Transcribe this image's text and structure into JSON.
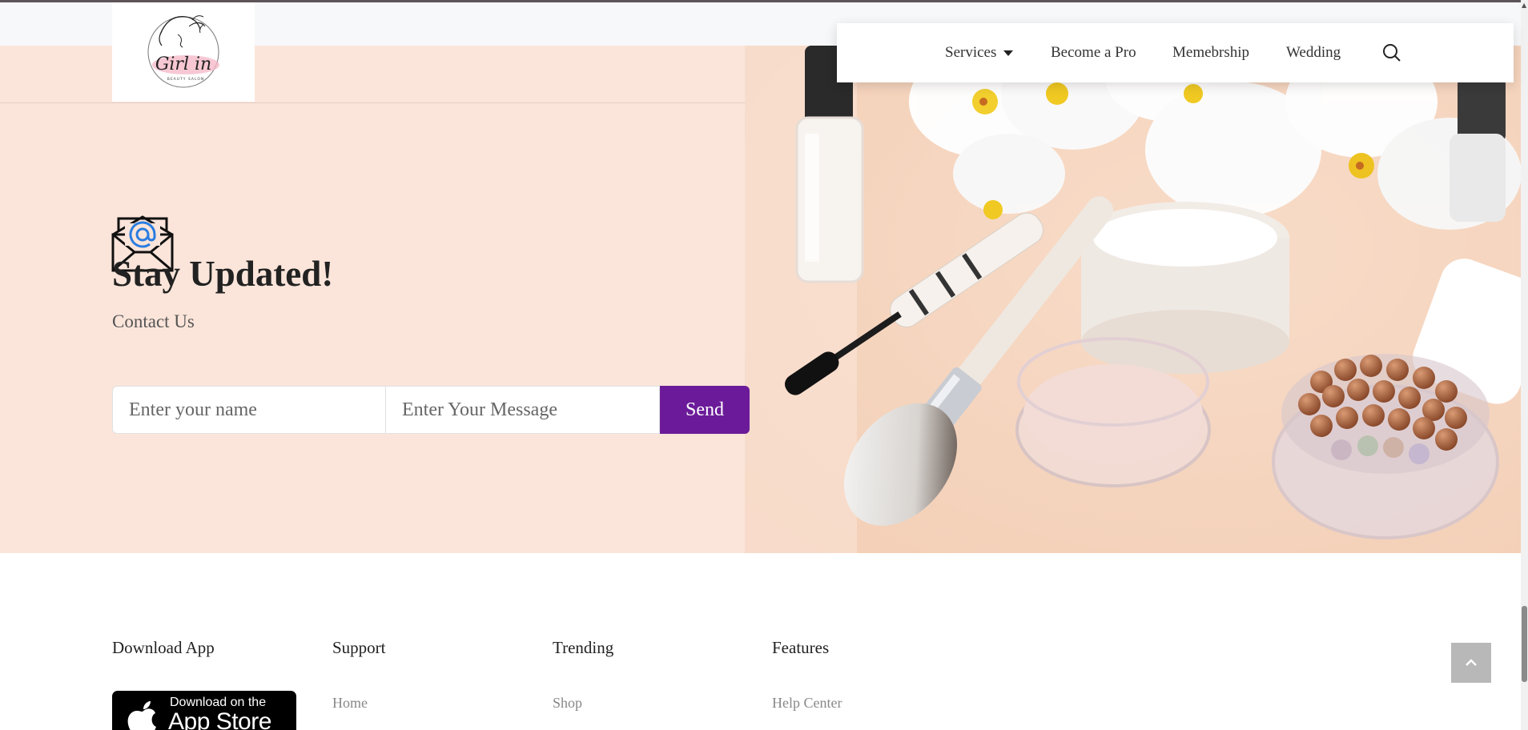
{
  "brand": {
    "logo_text": "Girl in",
    "logo_subtext": "BEAUTY SALON"
  },
  "nav": {
    "items": [
      {
        "label": "Services",
        "has_dropdown": true
      },
      {
        "label": "Become a Pro"
      },
      {
        "label": "Memebrship"
      },
      {
        "label": "Wedding"
      }
    ],
    "search_icon": "search-icon"
  },
  "hero": {
    "icon": "envelope-at-icon",
    "title": "Stay Updated!",
    "subtitle": "Contact Us",
    "form": {
      "name_placeholder": "Enter your name",
      "message_placeholder": "Enter Your Message",
      "send_label": "Send"
    },
    "image": "cosmetics-photo"
  },
  "footer": {
    "columns": [
      {
        "heading": "Download App"
      },
      {
        "heading": "Support",
        "links": [
          "Home"
        ]
      },
      {
        "heading": "Trending",
        "links": [
          "Shop"
        ]
      },
      {
        "heading": "Features",
        "links": [
          "Help Center"
        ]
      }
    ],
    "app_store": {
      "small": "Download on the",
      "big": "App Store"
    },
    "back_to_top_icon": "chevron-up-icon"
  },
  "colors": {
    "hero_bg": "#fbe5da",
    "send_button": "#6b1b9a",
    "back_to_top": "#b8b8b8"
  }
}
